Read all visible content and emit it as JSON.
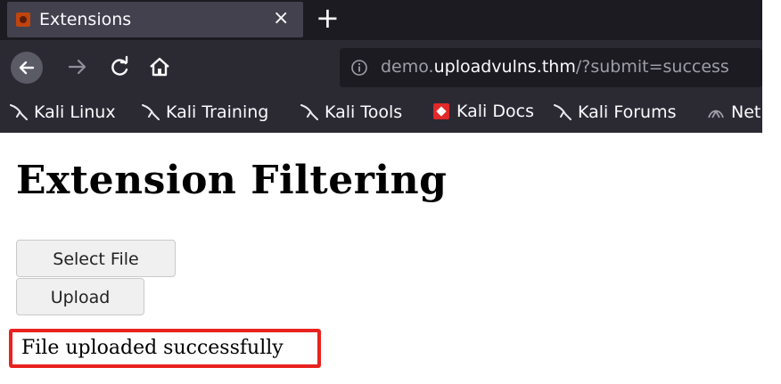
{
  "tab": {
    "title": "Extensions",
    "close": "×",
    "new_tab": "+"
  },
  "nav": {
    "url_prefix": "demo.",
    "url_host": "uploadvulns.thm",
    "url_path": "/?submit=success"
  },
  "bookmarks": [
    {
      "label": "Kali Linux"
    },
    {
      "label": "Kali Training"
    },
    {
      "label": "Kali Tools"
    },
    {
      "label": "Kali Docs"
    },
    {
      "label": "Kali Forums"
    },
    {
      "label": "Net"
    }
  ],
  "page": {
    "title": "Extension Filtering",
    "select_file": "Select File",
    "upload": "Upload",
    "status": "File uploaded successfully"
  },
  "colors": {
    "highlight": "#e8221e",
    "toolbar": "#2b2a33"
  }
}
